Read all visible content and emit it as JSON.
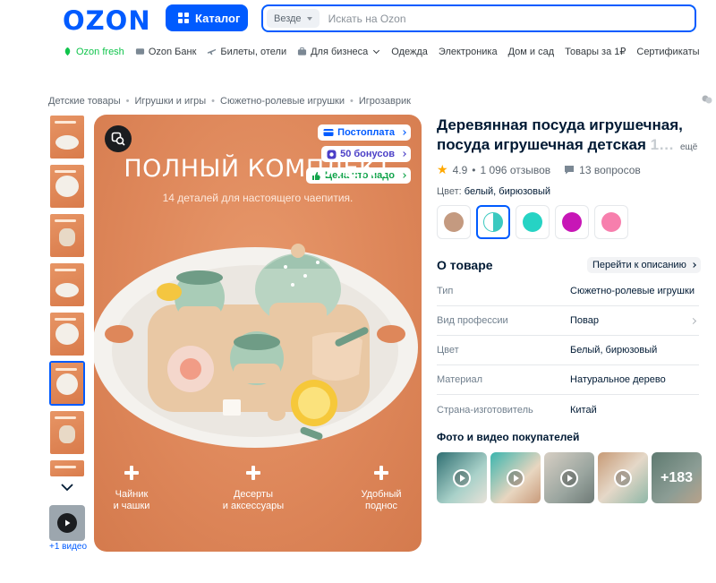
{
  "header": {
    "logo": "OZON",
    "catalog_label": "Каталог",
    "search": {
      "scope": "Везде",
      "placeholder": "Искать на Ozon"
    }
  },
  "nav": {
    "items": [
      {
        "label": "Ozon fresh",
        "icon": "leaf-icon"
      },
      {
        "label": "Ozon Банк",
        "icon": "card-icon"
      },
      {
        "label": "Билеты, отели",
        "icon": "plane-icon"
      },
      {
        "label": "Для бизнеса",
        "icon": "briefcase-icon"
      },
      {
        "label": "Одежда"
      },
      {
        "label": "Электроника"
      },
      {
        "label": "Дом и сад"
      },
      {
        "label": "Товары за 1₽"
      },
      {
        "label": "Сертификаты"
      }
    ]
  },
  "breadcrumb": [
    "Детские товары",
    "Игрушки и игры",
    "Сюжетно-ролевые игрушки",
    "Игрозаврик"
  ],
  "gallery": {
    "video_caption": "+1 видео",
    "image_title": "ПОЛНЫЙ КОМПЛЕКТ",
    "image_subtitle": "14 деталей для настоящего чаепития.",
    "promos": [
      "Постоплата",
      "50 бонусов",
      "Цена что надо"
    ],
    "features": [
      {
        "line1": "Чайник",
        "line2": "и чашки"
      },
      {
        "line1": "Десерты",
        "line2": "и аксессуары"
      },
      {
        "line1": "Удобный",
        "line2": "поднос"
      }
    ]
  },
  "product": {
    "title_line1": "Деревянная посуда игрушечная,",
    "title_line2": "посуда игрушечная детская",
    "title_fade": " 1…",
    "title_more": "ещё",
    "rating": "4.9",
    "reviews": "1 096 отзывов",
    "questions": "13 вопросов",
    "color_label": "Цвет:",
    "color_value": "белый, бирюзовый",
    "swatch_colors": [
      "#c49a80",
      "#3bc9c0",
      "#26d3c4",
      "#c716b6",
      "#f77fad"
    ]
  },
  "about": {
    "title": "О товаре",
    "goto_label": "Перейти к описанию",
    "specs": [
      {
        "key": "Тип",
        "value": "Сюжетно-ролевые игрушки"
      },
      {
        "key": "Вид профессии",
        "value": "Повар"
      },
      {
        "key": "Цвет",
        "value": "Белый, бирюзовый"
      },
      {
        "key": "Материал",
        "value": "Натуральное дерево"
      },
      {
        "key": "Страна-изготовитель",
        "value": "Китай"
      }
    ]
  },
  "customer_photos": {
    "title": "Фото и видео покупателей",
    "more_count": "+183"
  }
}
